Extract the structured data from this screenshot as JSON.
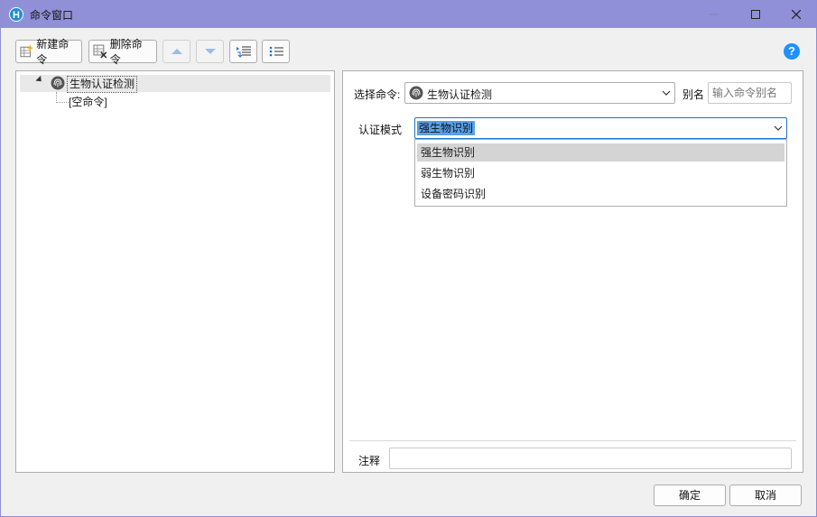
{
  "window": {
    "title": "命令窗口",
    "icon_letter": "H",
    "icons": [
      "app-icon",
      "minimize-icon",
      "maximize-icon",
      "close-icon"
    ]
  },
  "toolbar": {
    "new_label": "新建命令",
    "delete_label": "删除命令",
    "icons": [
      "new-command-icon",
      "delete-command-icon",
      "move-up-icon",
      "move-down-icon",
      "indent-icon",
      "outdent-icon",
      "help-icon"
    ],
    "help_glyph": "?"
  },
  "tree": {
    "items": [
      {
        "label": "生物认证检测",
        "icon": "fingerprint-icon",
        "selected": true,
        "expanded": true
      },
      {
        "label": "[空命令]",
        "icon": null,
        "selected": false
      }
    ]
  },
  "form": {
    "select_label": "选择命令:",
    "select_value": "生物认证检测",
    "select_icon": "fingerprint-icon",
    "alias_label": "别名",
    "alias_placeholder": "输入命令别名",
    "mode_label": "认证模式",
    "mode_value": "强生物识别",
    "mode_options": [
      "强生物识别",
      "弱生物识别",
      "设备密码识别"
    ],
    "comment_label": "注释"
  },
  "buttons": {
    "ok": "确定",
    "cancel": "取消"
  },
  "colors": {
    "titlebar": "#9090d8",
    "accent": "#1e90ff",
    "selection": "#5aa0e8"
  }
}
